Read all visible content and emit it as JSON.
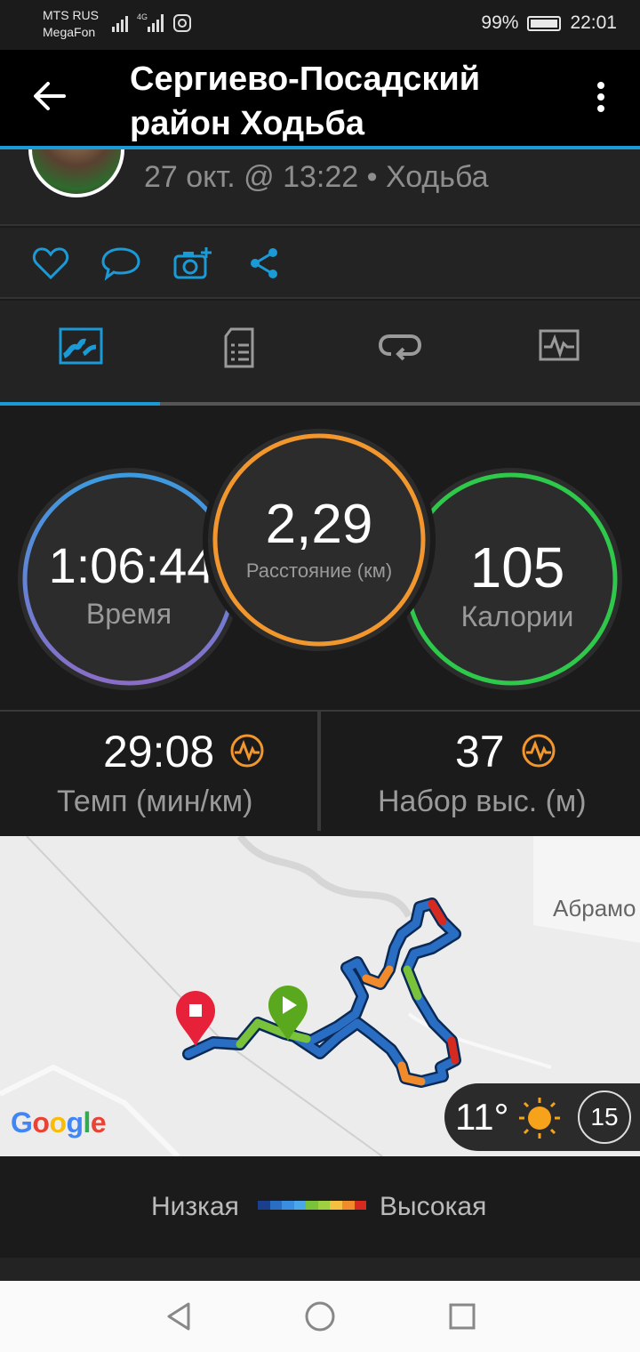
{
  "status_bar": {
    "carrier_1": "MTS RUS",
    "carrier_2": "MegaFon",
    "battery": "99%",
    "time": "22:01"
  },
  "app_bar": {
    "title": "Сергиево-Посадский район Ходьба"
  },
  "activity": {
    "meta": "27 окт. @ 13:22 • Ходьба"
  },
  "action_icons": [
    "like-icon",
    "comment-icon",
    "add-photo-icon",
    "share-icon"
  ],
  "tab_icons": [
    "overview-tab-icon",
    "details-tab-icon",
    "laps-tab-icon",
    "charts-tab-icon"
  ],
  "rings": {
    "time": {
      "value": "1:06:44",
      "label": "Время"
    },
    "distance": {
      "value": "2,29",
      "label": "Расстояние (км)"
    },
    "calories": {
      "value": "105",
      "label": "Калории"
    }
  },
  "metrics": {
    "pace": {
      "value": "29:08",
      "label": "Темп (мин/км)"
    },
    "elevation": {
      "value": "37",
      "label": "Набор выс. (м)"
    }
  },
  "map": {
    "place_label": "Абрамо",
    "google": "Google",
    "weather_temp": "11°",
    "wind_speed": "15"
  },
  "legend": {
    "low": "Низкая",
    "high": "Высокая"
  },
  "colors": {
    "accent": "#1a9ad6",
    "ring_time": "#6a8fd8",
    "ring_distance": "#f2962e",
    "ring_calories": "#2ec84a",
    "start_marker": "#5aa81e",
    "end_marker": "#e8213a"
  }
}
